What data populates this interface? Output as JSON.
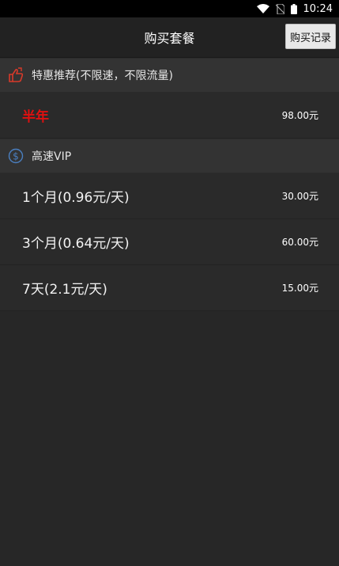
{
  "status_bar": {
    "time": "10:24"
  },
  "appbar": {
    "title": "购买套餐",
    "record_button": "购买记录"
  },
  "sections": [
    {
      "header": "特惠推荐(不限速，不限流量)",
      "icon": "thumbs-up-icon",
      "items": [
        {
          "name": "半年",
          "price": "98.00元"
        }
      ]
    },
    {
      "header": "高速VIP",
      "icon": "dollar-coin-icon",
      "items": [
        {
          "name": "1个月(0.96元/天)",
          "price": "30.00元"
        },
        {
          "name": "3个月(0.64元/天)",
          "price": "60.00元"
        },
        {
          "name": "7天(2.1元/天)",
          "price": "15.00元"
        }
      ]
    }
  ],
  "colors": {
    "background": "#272727",
    "promo_text": "#e01010",
    "section_header_bg": "#333333",
    "promo_icon": "#d83a2a",
    "vip_icon": "#4a7fc0"
  }
}
